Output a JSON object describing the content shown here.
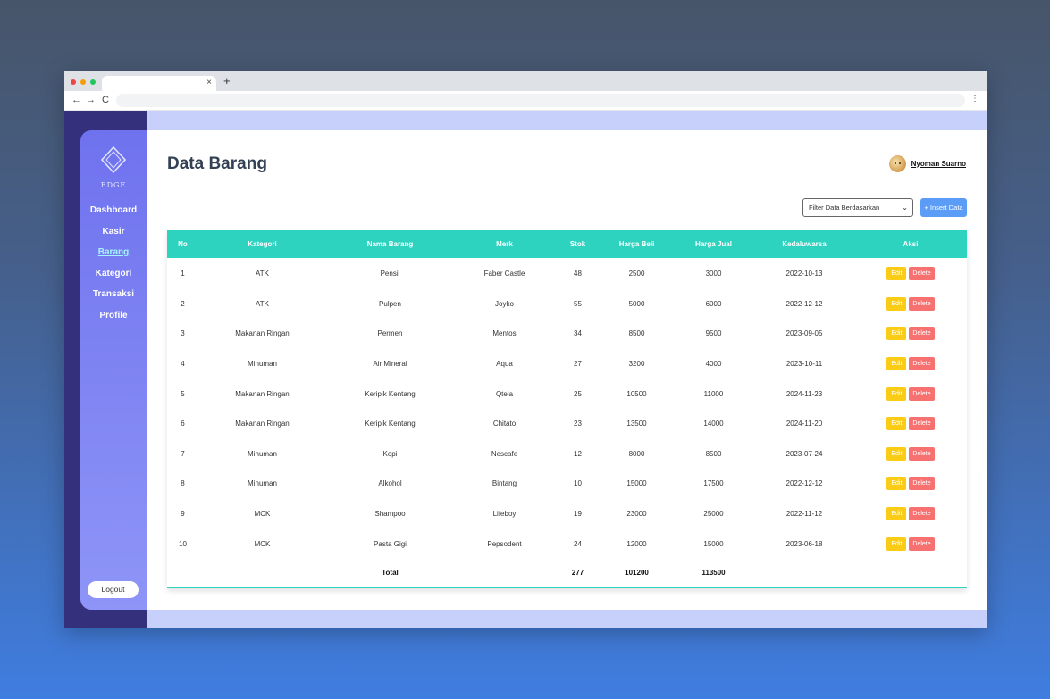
{
  "window": {
    "new_tab": "+",
    "close_tab": "×",
    "nav_back": "←",
    "nav_forward": "→",
    "nav_reload": "C",
    "menu": "⋮"
  },
  "sidebar": {
    "logo_text": "EDGE",
    "items": [
      {
        "label": "Dashboard"
      },
      {
        "label": "Kasir"
      },
      {
        "label": "Barang",
        "active": true
      },
      {
        "label": "Kategori"
      },
      {
        "label": "Transaksi"
      },
      {
        "label": "Profile"
      }
    ],
    "logout_label": "Logout"
  },
  "header": {
    "title": "Data Barang",
    "user_name": "Nyoman Suarno"
  },
  "toolbar": {
    "filter_label": "Filter Data Berdasarkan",
    "insert_label": "+ Insert Data"
  },
  "table": {
    "headers": [
      "No",
      "Kategori",
      "Nama Barang",
      "Merk",
      "Stok",
      "Harga Beli",
      "Harga Jual",
      "Kedaluwarsa",
      "Aksi"
    ],
    "rows": [
      {
        "no": "1",
        "kategori": "ATK",
        "nama": "Pensil",
        "merk": "Faber Castle",
        "stok": "48",
        "beli": "2500",
        "jual": "3000",
        "exp": "2022-10-13"
      },
      {
        "no": "2",
        "kategori": "ATK",
        "nama": "Pulpen",
        "merk": "Joyko",
        "stok": "55",
        "beli": "5000",
        "jual": "6000",
        "exp": "2022-12-12"
      },
      {
        "no": "3",
        "kategori": "Makanan Ringan",
        "nama": "Permen",
        "merk": "Mentos",
        "stok": "34",
        "beli": "8500",
        "jual": "9500",
        "exp": "2023-09-05"
      },
      {
        "no": "4",
        "kategori": "Minuman",
        "nama": "Air Mineral",
        "merk": "Aqua",
        "stok": "27",
        "beli": "3200",
        "jual": "4000",
        "exp": "2023-10-11"
      },
      {
        "no": "5",
        "kategori": "Makanan Ringan",
        "nama": "Keripik Kentang",
        "merk": "Qtela",
        "stok": "25",
        "beli": "10500",
        "jual": "11000",
        "exp": "2024-11-23"
      },
      {
        "no": "6",
        "kategori": "Makanan Ringan",
        "nama": "Keripik Kentang",
        "merk": "Chitato",
        "stok": "23",
        "beli": "13500",
        "jual": "14000",
        "exp": "2024-11-20"
      },
      {
        "no": "7",
        "kategori": "Minuman",
        "nama": "Kopi",
        "merk": "Nescafe",
        "stok": "12",
        "beli": "8000",
        "jual": "8500",
        "exp": "2023-07-24"
      },
      {
        "no": "8",
        "kategori": "Minuman",
        "nama": "Alkohol",
        "merk": "Bintang",
        "stok": "10",
        "beli": "15000",
        "jual": "17500",
        "exp": "2022-12-12"
      },
      {
        "no": "9",
        "kategori": "MCK",
        "nama": "Shampoo",
        "merk": "Lifeboy",
        "stok": "19",
        "beli": "23000",
        "jual": "25000",
        "exp": "2022-11-12"
      },
      {
        "no": "10",
        "kategori": "MCK",
        "nama": "Pasta Gigi",
        "merk": "Pepsodent",
        "stok": "24",
        "beli": "12000",
        "jual": "15000",
        "exp": "2023-06-18"
      }
    ],
    "edit_label": "Edit",
    "delete_label": "Delete",
    "total": {
      "label": "Total",
      "stok": "277",
      "beli": "101200",
      "jual": "113500"
    }
  },
  "colors": {
    "accent": "#2ed3c0",
    "sidebar": "#7b80f2",
    "edit": "#facc15",
    "delete": "#f87171",
    "insert": "#5b9cf7"
  }
}
